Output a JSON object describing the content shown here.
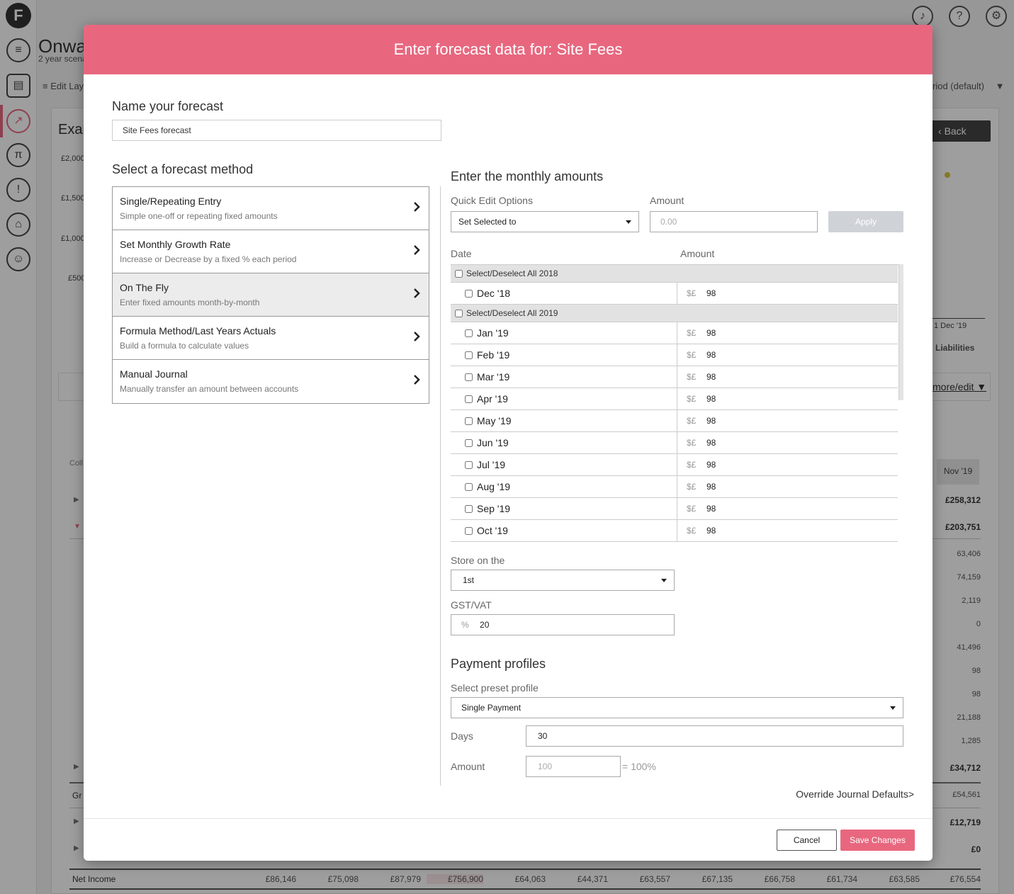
{
  "background": {
    "page_title": "Onwa",
    "page_subtitle": "2 year scena",
    "edit_layout": "Edit Lay",
    "period_select": "riod (default)",
    "card_title": "Exar",
    "back_button": "Back",
    "y_ticks": [
      "£2,000",
      "£1,500",
      "£1,000",
      "£500"
    ],
    "x_tick": "1 Dec '19",
    "legend_liabilities": "Liabilities",
    "more_edit": "more/edit",
    "column_label": "Coll",
    "column_header": "Nov '19",
    "right_values": [
      "£258,312",
      "£203,751",
      "63,406",
      "74,159",
      "2,119",
      "0",
      "41,496",
      "98",
      "98",
      "21,188",
      "1,285",
      "£34,712",
      "£54,561",
      "£12,719",
      "£0"
    ],
    "row_label_gr": "Gr",
    "net_income": {
      "label": "Net Income",
      "values": [
        "£86,146",
        "£75,098",
        "£87,979",
        "£756,900",
        "£64,063",
        "£44,371",
        "£63,557",
        "£67,135",
        "£66,758",
        "£61,734",
        "£63,585",
        "£76,554"
      ]
    }
  },
  "modal": {
    "title": "Enter forecast data for: Site Fees",
    "name_section": "Name your forecast",
    "name_value": "Site Fees forecast",
    "method_section": "Select a forecast method",
    "methods": [
      {
        "title": "Single/Repeating Entry",
        "desc": "Simple one-off or repeating fixed amounts",
        "selected": false
      },
      {
        "title": "Set Monthly Growth Rate",
        "desc": "Increase or Decrease by a fixed % each period",
        "selected": false
      },
      {
        "title": "On The Fly",
        "desc": "Enter fixed amounts month-by-month",
        "selected": true
      },
      {
        "title": "Formula Method/Last Years Actuals",
        "desc": "Build a formula to calculate values",
        "selected": false
      },
      {
        "title": "Manual Journal",
        "desc": "Manually transfer an amount between accounts",
        "selected": false
      }
    ],
    "monthly_section": "Enter the monthly amounts",
    "quick_edit_label": "Quick Edit Options",
    "quick_edit_value": "Set Selected to",
    "amount_label": "Amount",
    "amount_placeholder": "0.00",
    "apply_label": "Apply",
    "table": {
      "date_header": "Date",
      "amount_header": "Amount",
      "currency": "$£",
      "group_2018": "Select/Deselect All 2018",
      "group_2019": "Select/Deselect All 2019",
      "rows_2018": [
        {
          "date": "Dec '18",
          "amount": "98"
        }
      ],
      "rows_2019": [
        {
          "date": "Jan '19",
          "amount": "98"
        },
        {
          "date": "Feb '19",
          "amount": "98"
        },
        {
          "date": "Mar '19",
          "amount": "98"
        },
        {
          "date": "Apr '19",
          "amount": "98"
        },
        {
          "date": "May '19",
          "amount": "98"
        },
        {
          "date": "Jun '19",
          "amount": "98"
        },
        {
          "date": "Jul '19",
          "amount": "98"
        },
        {
          "date": "Aug '19",
          "amount": "98"
        },
        {
          "date": "Sep '19",
          "amount": "98"
        },
        {
          "date": "Oct '19",
          "amount": "98"
        }
      ]
    },
    "store_label": "Store on the",
    "store_value": "1st",
    "gst_label": "GST/VAT",
    "gst_unit": "%",
    "gst_value": "20",
    "payment_section": "Payment profiles",
    "preset_label": "Select preset profile",
    "preset_value": "Single Payment",
    "days_label": "Days",
    "days_value": "30",
    "pay_amount_label": "Amount",
    "pay_amount_placeholder": "100",
    "pay_amount_suffix": "= 100%",
    "override_link": "Override Journal Defaults>",
    "cancel_label": "Cancel",
    "save_label": "Save Changes"
  },
  "colors": {
    "accent": "#e8677f",
    "apply_disabled": "#cfd3d8",
    "selected_method_bg": "#ececec"
  }
}
